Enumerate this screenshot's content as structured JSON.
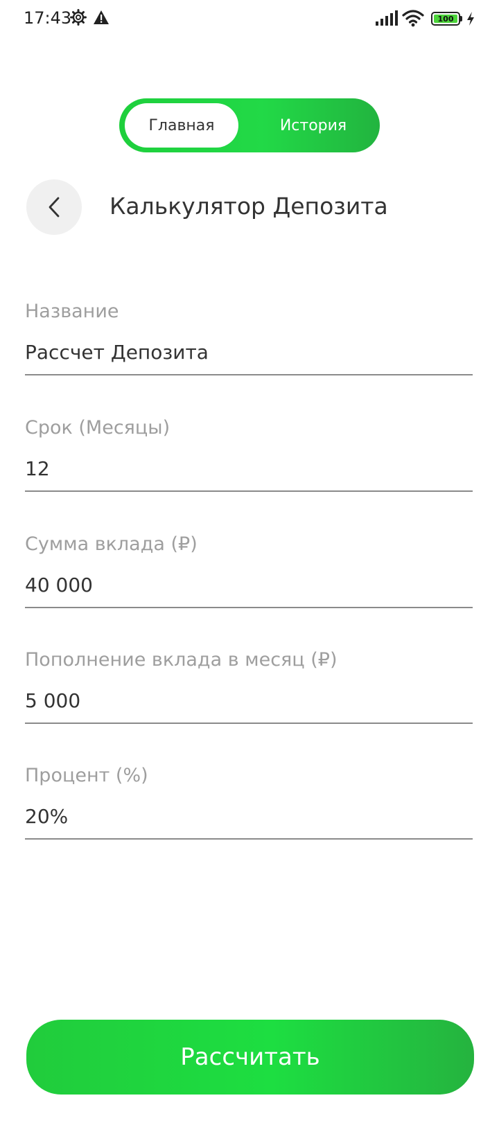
{
  "status_bar": {
    "time": "17:43",
    "battery_level": "100",
    "icons": [
      "gear-icon",
      "warning-icon",
      "cellular-signal-icon",
      "wifi-icon",
      "battery-icon",
      "charging-bolt-icon"
    ]
  },
  "tabs": {
    "home_label": "Главная",
    "history_label": "История",
    "active": "home"
  },
  "header": {
    "title": "Калькулятор Депозита",
    "back_icon": "chevron-left-icon"
  },
  "form": {
    "fields": [
      {
        "label": "Название",
        "value": "Рассчет Депозита"
      },
      {
        "label": "Срок (Месяцы)",
        "value": "12"
      },
      {
        "label": "Сумма вклада (₽)",
        "value": "40 000"
      },
      {
        "label": "Пополнение вклада в месяц (₽)",
        "value": "5 000"
      },
      {
        "label": "Процент (%)",
        "value": "20%"
      }
    ]
  },
  "actions": {
    "calculate_label": "Рассчитать"
  },
  "colors": {
    "accent_green": "#21d944",
    "label_gray": "#9e9e9e",
    "text_dark": "#333333"
  }
}
